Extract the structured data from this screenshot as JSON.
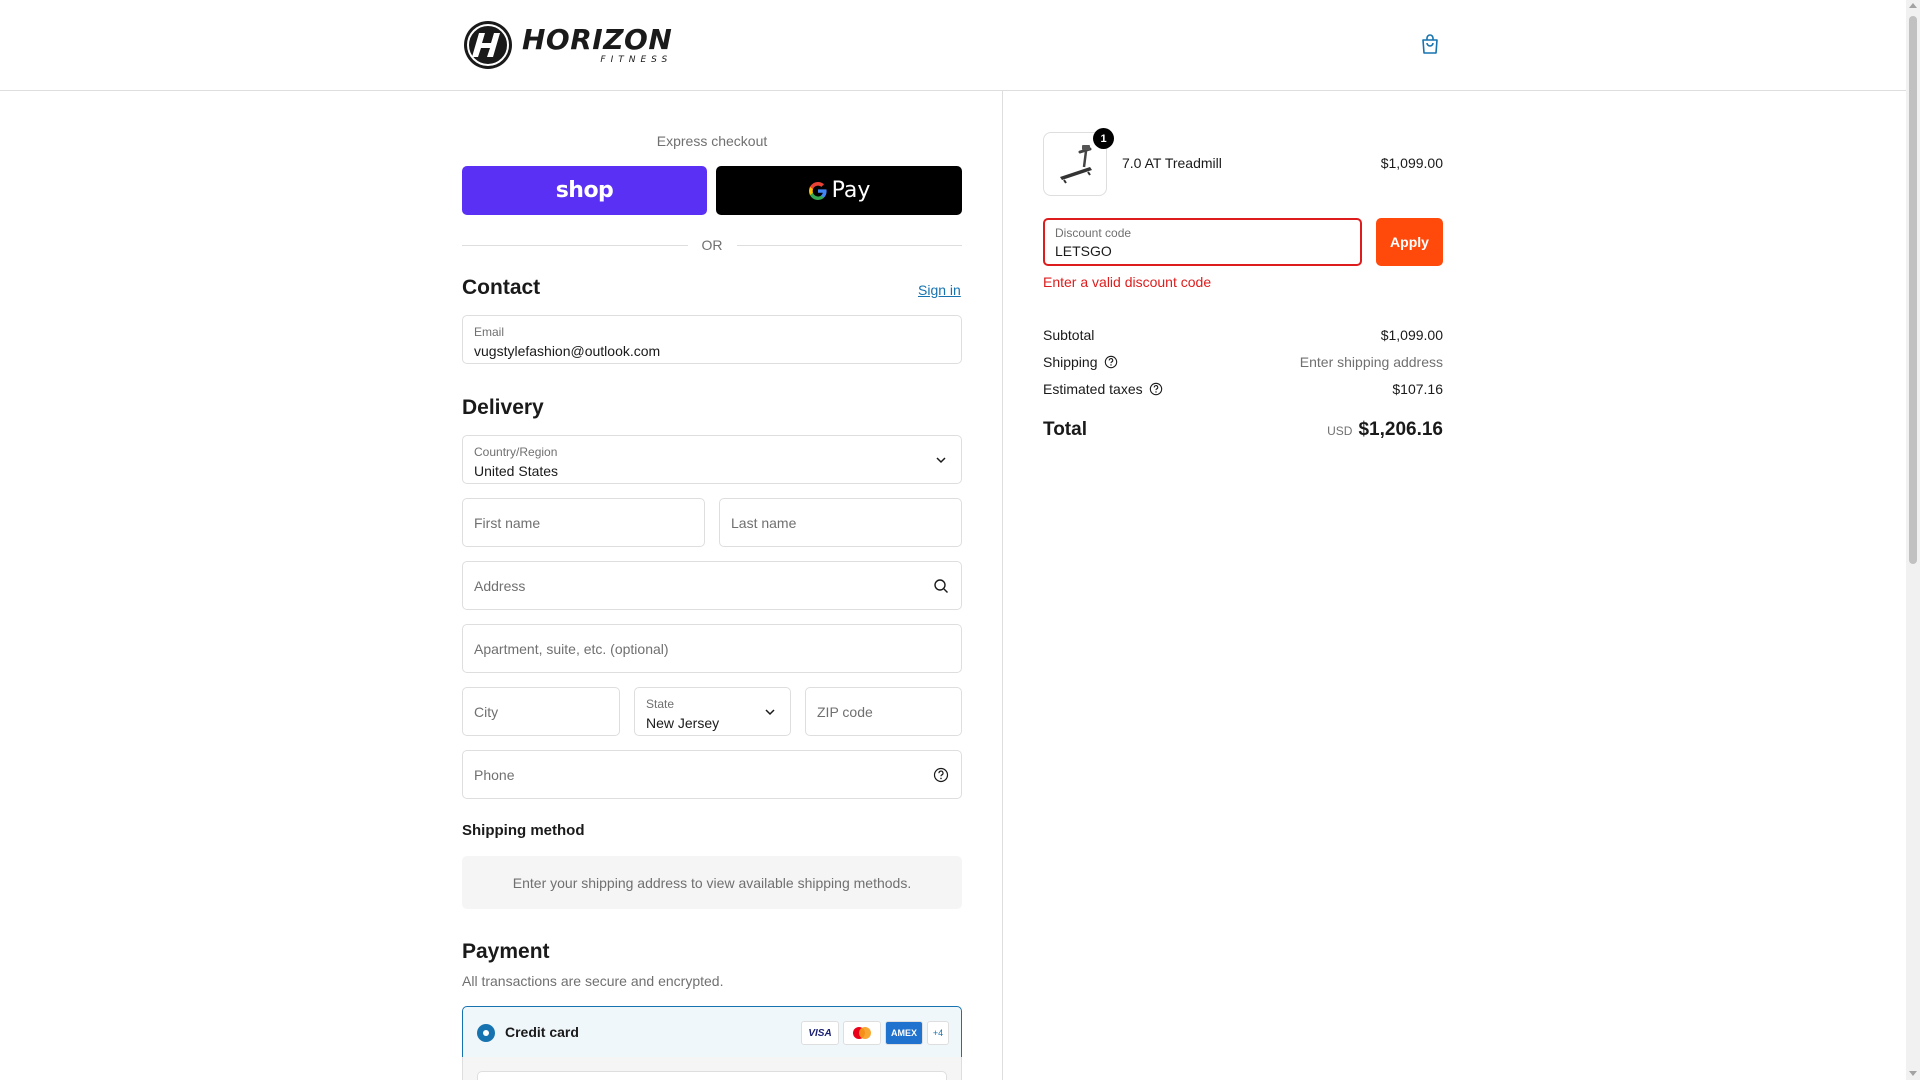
{
  "brand": {
    "name": "HORIZON",
    "sub": "FITNESS"
  },
  "express": {
    "title": "Express checkout",
    "shop_label": "shop",
    "gpay_label": "Pay",
    "or": "OR"
  },
  "contact": {
    "title": "Contact",
    "signin": "Sign in",
    "email_label": "Email",
    "email_value": "vugstylefashion@outlook.com"
  },
  "delivery": {
    "title": "Delivery",
    "country_label": "Country/Region",
    "country_value": "United States",
    "first_name": "First name",
    "last_name": "Last name",
    "address": "Address",
    "apartment": "Apartment, suite, etc. (optional)",
    "city": "City",
    "state_label": "State",
    "state_value": "New Jersey",
    "zip": "ZIP code",
    "phone": "Phone"
  },
  "shipping_method": {
    "title": "Shipping method",
    "message": "Enter your shipping address to view available shipping methods."
  },
  "payment": {
    "title": "Payment",
    "subtitle": "All transactions are secure and encrypted.",
    "credit_card": "Credit card",
    "cards": [
      "VISA",
      "",
      "AMEX"
    ],
    "more_cards": "+4"
  },
  "order": {
    "item": {
      "name": "7.0 AT Treadmill",
      "price": "$1,099.00",
      "quantity": "1"
    },
    "discount": {
      "label": "Discount code",
      "value": "LETSGO",
      "apply": "Apply",
      "error": "Enter a valid discount code"
    },
    "subtotal_label": "Subtotal",
    "subtotal": "$1,099.00",
    "shipping_label": "Shipping",
    "shipping": "Enter shipping address",
    "taxes_label": "Estimated taxes",
    "taxes": "$107.16",
    "total_label": "Total",
    "currency": "USD",
    "total": "$1,206.16"
  },
  "colors": {
    "shop": "#5a31f4",
    "accent": "#1773b0",
    "apply": "#ff4a0c",
    "error": "#dd1d1d"
  }
}
